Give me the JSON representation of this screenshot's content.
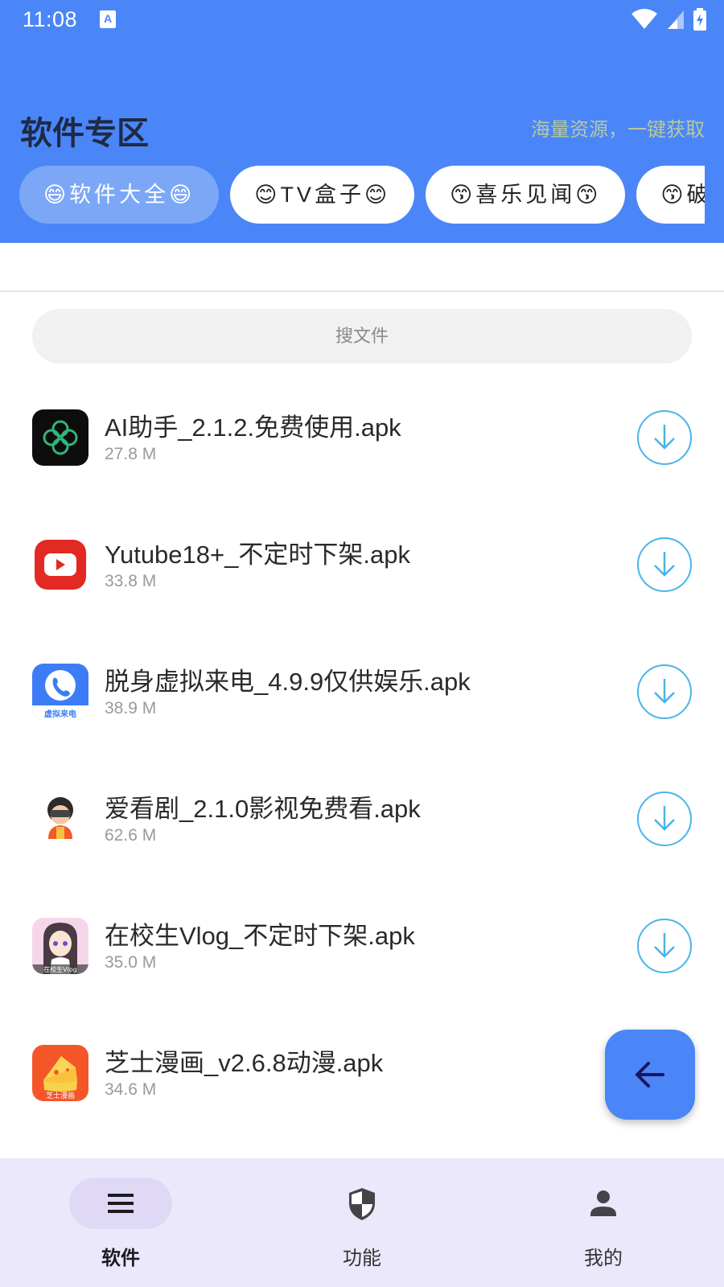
{
  "status": {
    "time": "11:08",
    "notification_letter": "A"
  },
  "header": {
    "title": "软件专区",
    "subtitle": "海量资源，一键获取",
    "chips": [
      "😄软件大全😄",
      "😊TV盒子😊",
      "😙喜乐见闻😙",
      "😙破"
    ]
  },
  "search": {
    "placeholder": "搜文件"
  },
  "files": [
    {
      "name": "AI助手_2.1.2.免费使用.apk",
      "size": "27.8 M",
      "icon": "ai-assistant-app-icon"
    },
    {
      "name": "Yutube18+_不定时下架.apk",
      "size": "33.8 M",
      "icon": "youtube-app-icon"
    },
    {
      "name": "脱身虚拟来电_4.9.9仅供娱乐.apk",
      "size": "38.9 M",
      "icon": "virtual-call-app-icon"
    },
    {
      "name": "爱看剧_2.1.0影视免费看.apk",
      "size": "62.6 M",
      "icon": "aikanju-app-icon"
    },
    {
      "name": "在校生Vlog_不定时下架.apk",
      "size": "35.0 M",
      "icon": "student-vlog-app-icon"
    },
    {
      "name": "芝士漫画_v2.6.8动漫.apk",
      "size": "34.6 M",
      "icon": "cheese-comic-app-icon"
    }
  ],
  "icon_text": {
    "virtual_call": "虚拟来电",
    "student_vlog": "在校生Vlog",
    "cheese": "芝士漫画"
  },
  "nav": [
    {
      "label": "软件",
      "icon": "menu-icon",
      "active": true
    },
    {
      "label": "功能",
      "icon": "shield-icon",
      "active": false
    },
    {
      "label": "我的",
      "icon": "person-icon",
      "active": false
    }
  ],
  "colors": {
    "primary": "#4a86f7",
    "download_ring": "#49b4ea",
    "nav_bg": "#ebe8fb"
  }
}
